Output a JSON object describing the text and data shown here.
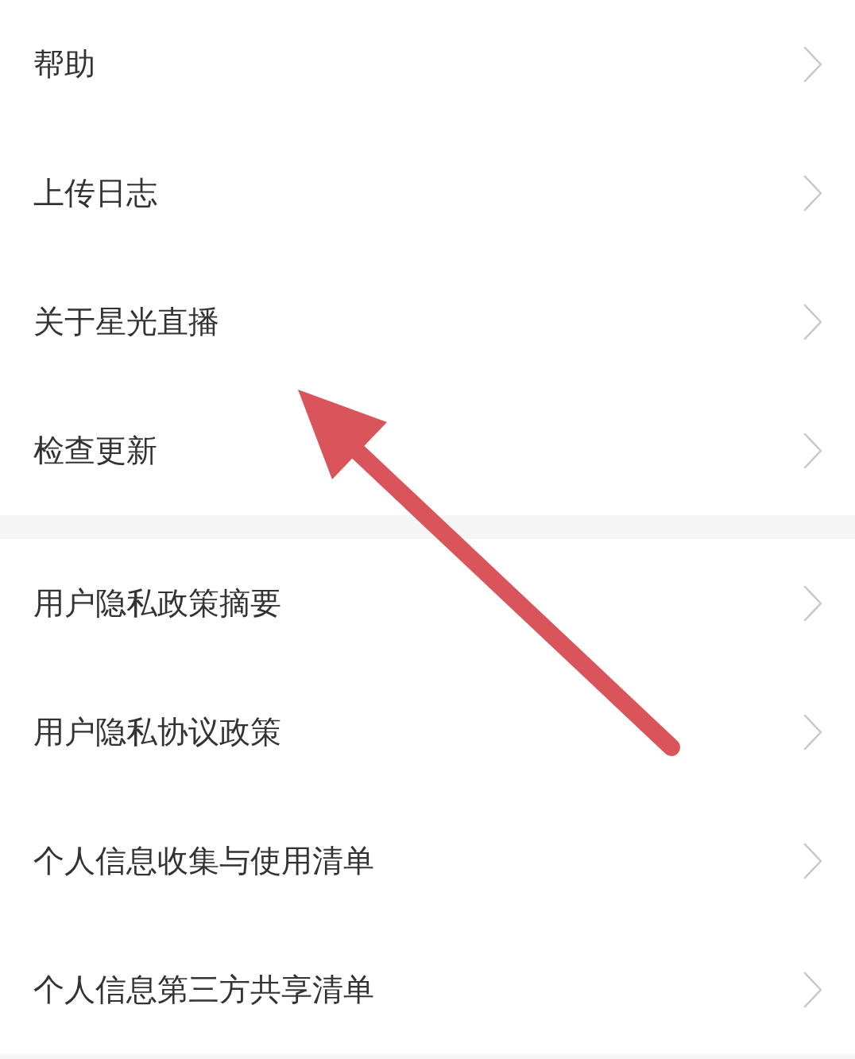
{
  "sections": [
    {
      "items": [
        {
          "label": "帮助"
        },
        {
          "label": "上传日志"
        },
        {
          "label": "关于星光直播"
        },
        {
          "label": "检查更新"
        }
      ]
    },
    {
      "items": [
        {
          "label": "用户隐私政策摘要"
        },
        {
          "label": "用户隐私协议政策"
        },
        {
          "label": "个人信息收集与使用清单"
        },
        {
          "label": "个人信息第三方共享清单"
        }
      ]
    }
  ]
}
